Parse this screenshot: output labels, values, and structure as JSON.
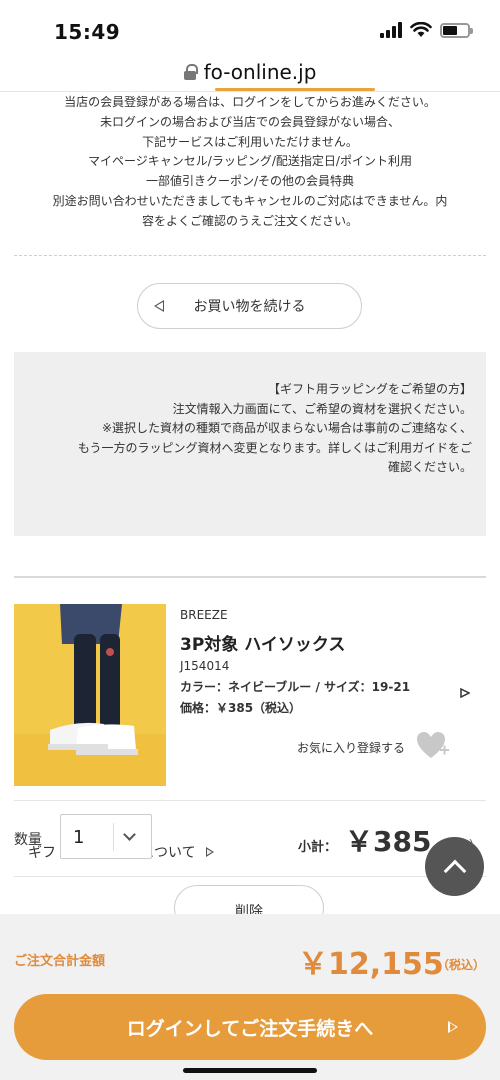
{
  "status_bar": {
    "time": "15:49"
  },
  "browser": {
    "url": "fo-online.jp"
  },
  "notice": {
    "lines": [
      "当店の会員登録がある場合は、ログインをしてからお進みください。",
      "未ログインの場合および当店での会員登録がない場合、",
      "下記サービスはご利用いただけません。",
      "マイページキャンセル/ラッピング/配送指定日/ポイント利用",
      "一部値引きクーポン/その他の会員特典",
      "別途お問い合わせいただきましてもキャンセルのご対応はできません。内",
      "容をよくご確認のうえご注文ください。"
    ]
  },
  "continue_shopping": {
    "label": "お買い物を続ける"
  },
  "gift": {
    "lines": [
      "【ギフト用ラッピングをご希望の方】",
      "注文情報入力画面にて、ご希望の資材を選択ください。",
      "※選択した資材の種類で商品が収まらない場合は事前のご連絡なく、",
      "もう一方のラッピング資材へ変更となります。詳しくはご利用ガイドをご",
      "確認ください。"
    ],
    "link_label": "ギフトラッピングについて"
  },
  "product": {
    "brand": "BREEZE",
    "name": "3P対象 ハイソックス",
    "code": "J154014",
    "spec": "カラー：ネイビーブルー / サイズ：19-21",
    "price": "価格：￥385（税込）",
    "favorite_label": "お気に入り登録する"
  },
  "quantity": {
    "label": "数量",
    "value": "1",
    "subtotal_label": "小計：",
    "subtotal_value": "￥385",
    "subtotal_tax": "（税込）"
  },
  "delete": {
    "label": "削除"
  },
  "order_total": {
    "label": "ご注文合計金額",
    "value": "￥12,155",
    "tax": "（税込）"
  },
  "checkout": {
    "label": "ログインしてご注文手続きへ"
  },
  "colors": {
    "accent": "#e79c3c",
    "total_text": "#e08a3c",
    "panel_bg": "#efefef",
    "product_bg": "#f3c94a"
  },
  "icons": [
    "lock-icon",
    "signal-icon",
    "wifi-icon",
    "battery-icon",
    "triangle-left-icon",
    "triangle-right-icon",
    "heart-plus-icon",
    "chevron-down-icon",
    "chevron-up-icon"
  ]
}
